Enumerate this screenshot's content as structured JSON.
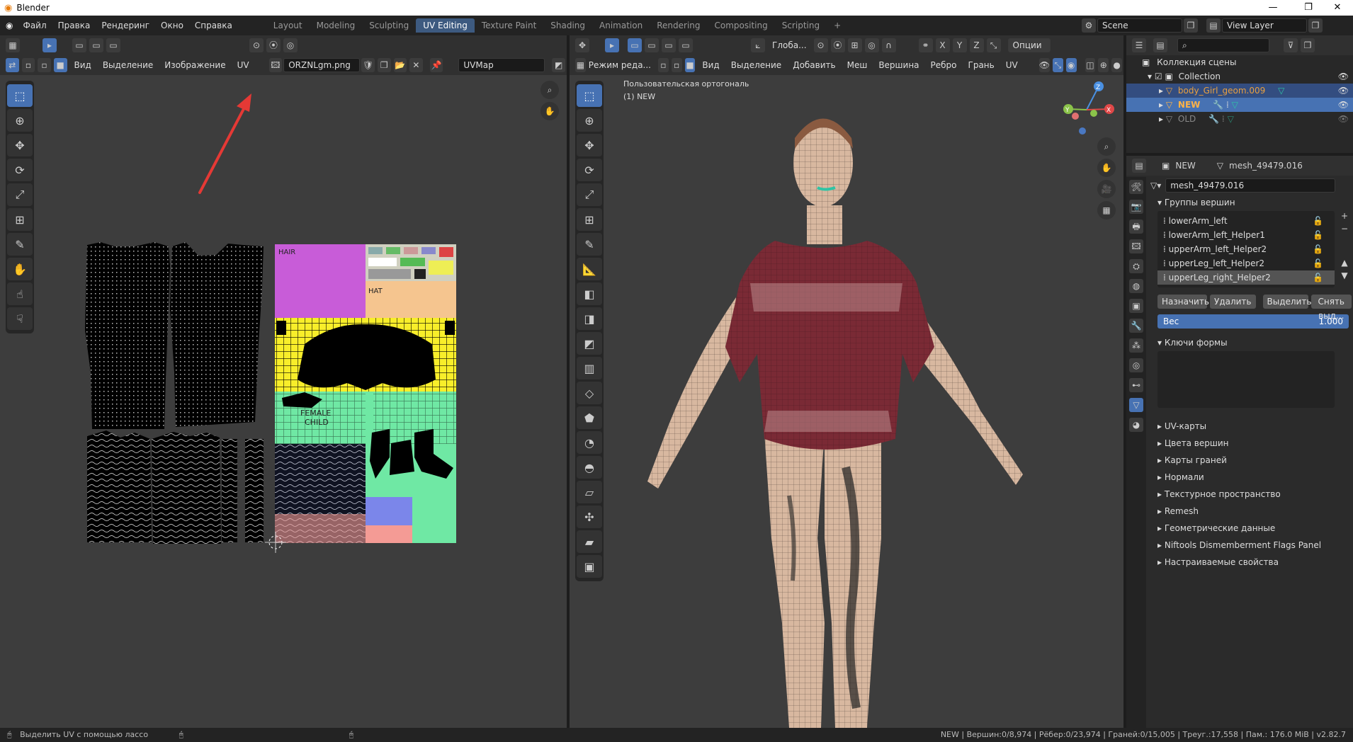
{
  "window": {
    "title": "Blender"
  },
  "menu": [
    "Файл",
    "Правка",
    "Рендеринг",
    "Окно",
    "Справка"
  ],
  "workspaces": [
    "Layout",
    "Modeling",
    "Sculpting",
    "UV Editing",
    "Texture Paint",
    "Shading",
    "Animation",
    "Rendering",
    "Compositing",
    "Scripting"
  ],
  "active_workspace": "UV Editing",
  "scene": {
    "name": "Scene",
    "view_layer": "View Layer"
  },
  "uv_editor": {
    "menus": [
      "Вид",
      "Выделение",
      "Изображение",
      "UV"
    ],
    "image_name": "ORZNLgm.png",
    "uvmap": "UVMap",
    "texture_labels": {
      "hair": "HAIR",
      "hat": "HAT",
      "female": "FEMALE",
      "child": "CHILD"
    }
  },
  "viewport": {
    "mode": "Режим реда...",
    "menus": [
      "Вид",
      "Выделение",
      "Добавить",
      "Меш",
      "Вершина",
      "Ребро",
      "Грань",
      "UV"
    ],
    "orientation": "Глоба...",
    "axes": [
      "X",
      "Y",
      "Z"
    ],
    "options": "Опции",
    "overlay_title": "Пользовательская ортогональ",
    "overlay_obj": "(1) NEW",
    "gizmo": {
      "z": "Z",
      "y": "Y",
      "x": "X"
    }
  },
  "outliner": {
    "title": "Коллекция сцены",
    "collection": "Collection",
    "items": [
      {
        "name": "body_Girl_geom.009",
        "color": "#e8a040"
      },
      {
        "name": "NEW",
        "color": "#ffb347"
      },
      {
        "name": "OLD",
        "color": "#888888"
      }
    ]
  },
  "properties": {
    "object": "NEW",
    "mesh": "mesh_49479.016",
    "mesh_field": "mesh_49479.016",
    "vertex_groups_title": "Группы вершин",
    "vertex_groups": [
      "lowerArm_left",
      "lowerArm_left_Helper1",
      "upperArm_left_Helper2",
      "upperLeg_left_Helper2",
      "upperLeg_right_Helper2"
    ],
    "buttons": {
      "assign": "Назначить",
      "remove": "Удалить",
      "select": "Выделить",
      "deselect": "Снять выд..."
    },
    "weight_label": "Вес",
    "weight_value": "1.000",
    "shape_keys_title": "Ключи формы",
    "panels": [
      "UV-карты",
      "Цвета вершин",
      "Карты граней",
      "Нормали",
      "Текстурное пространство",
      "Remesh",
      "Геометрические данные",
      "Niftools Dismemberment Flags Panel",
      "Настраиваемые свойства"
    ]
  },
  "status": {
    "left": "Выделить UV с помощью лассо",
    "right": "NEW | Вершин:0/8,974 | Рёбер:0/23,974 | Граней:0/15,005 | Треуг.:17,558 | Пам.: 176.0 MiB | v2.82.7"
  },
  "colors": {
    "accent": "#4772b3",
    "arrow": "#e53935"
  }
}
